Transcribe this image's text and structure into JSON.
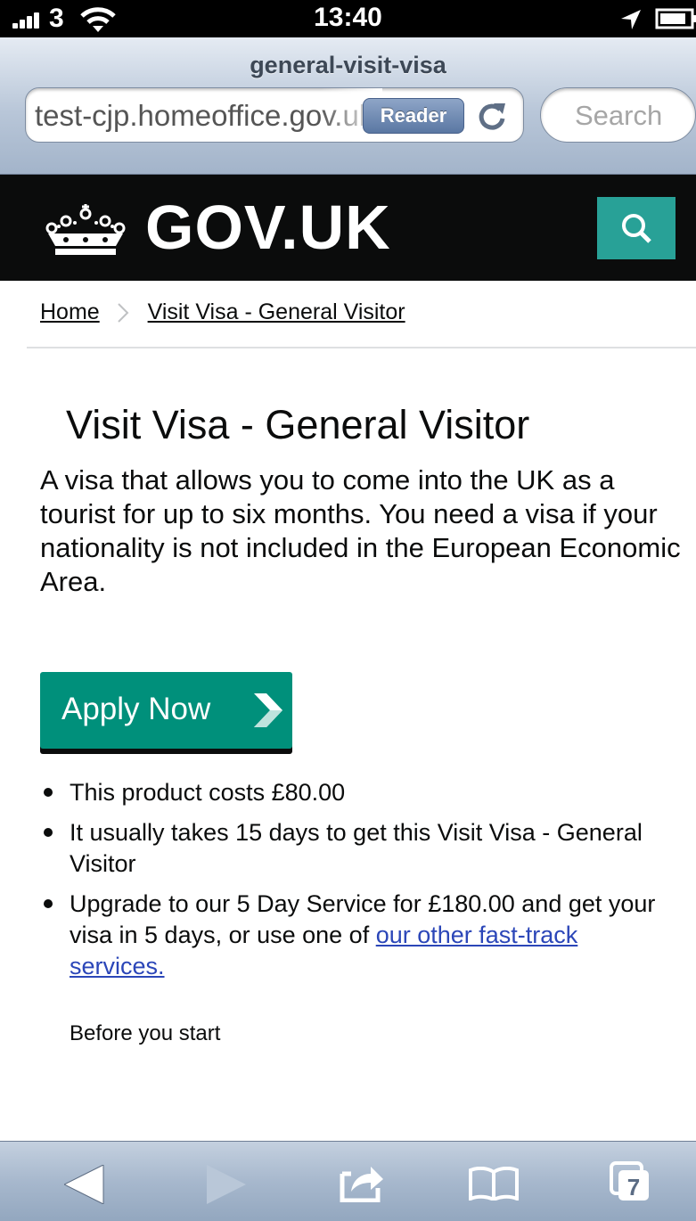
{
  "status_bar": {
    "carrier": "3",
    "time": "13:40"
  },
  "browser": {
    "page_title": "general-visit-visa",
    "url": "test-cjp.homeoffice.gov.uk",
    "reader_label": "Reader",
    "search_placeholder": "Search",
    "tab_count": "7"
  },
  "site_header": {
    "logo_text": "GOV.UK"
  },
  "breadcrumb": {
    "items": [
      "Home",
      "Visit Visa - General Visitor"
    ]
  },
  "content": {
    "heading": "Visit Visa - General Visitor",
    "intro": "A visa that allows you to come into the UK as a tourist for up to six months. You need a visa if your nationality is not included in the European Economic Area.",
    "apply_button": "Apply Now",
    "bullets": [
      "This product costs £80.00",
      "It usually takes 15 days to get this Visit Visa - General Visitor"
    ],
    "upgrade_text": "Upgrade to our 5 Day Service for £180.00 and get your visa in 5 days, or use one of ",
    "upgrade_link": "our other fast-track services.",
    "before_start": "Before you start"
  },
  "colors": {
    "gov_header_bg": "#0b0c0c",
    "gov_search_bg": "#28a197",
    "apply_button_bg": "#00907b",
    "link": "#2b46b8"
  }
}
